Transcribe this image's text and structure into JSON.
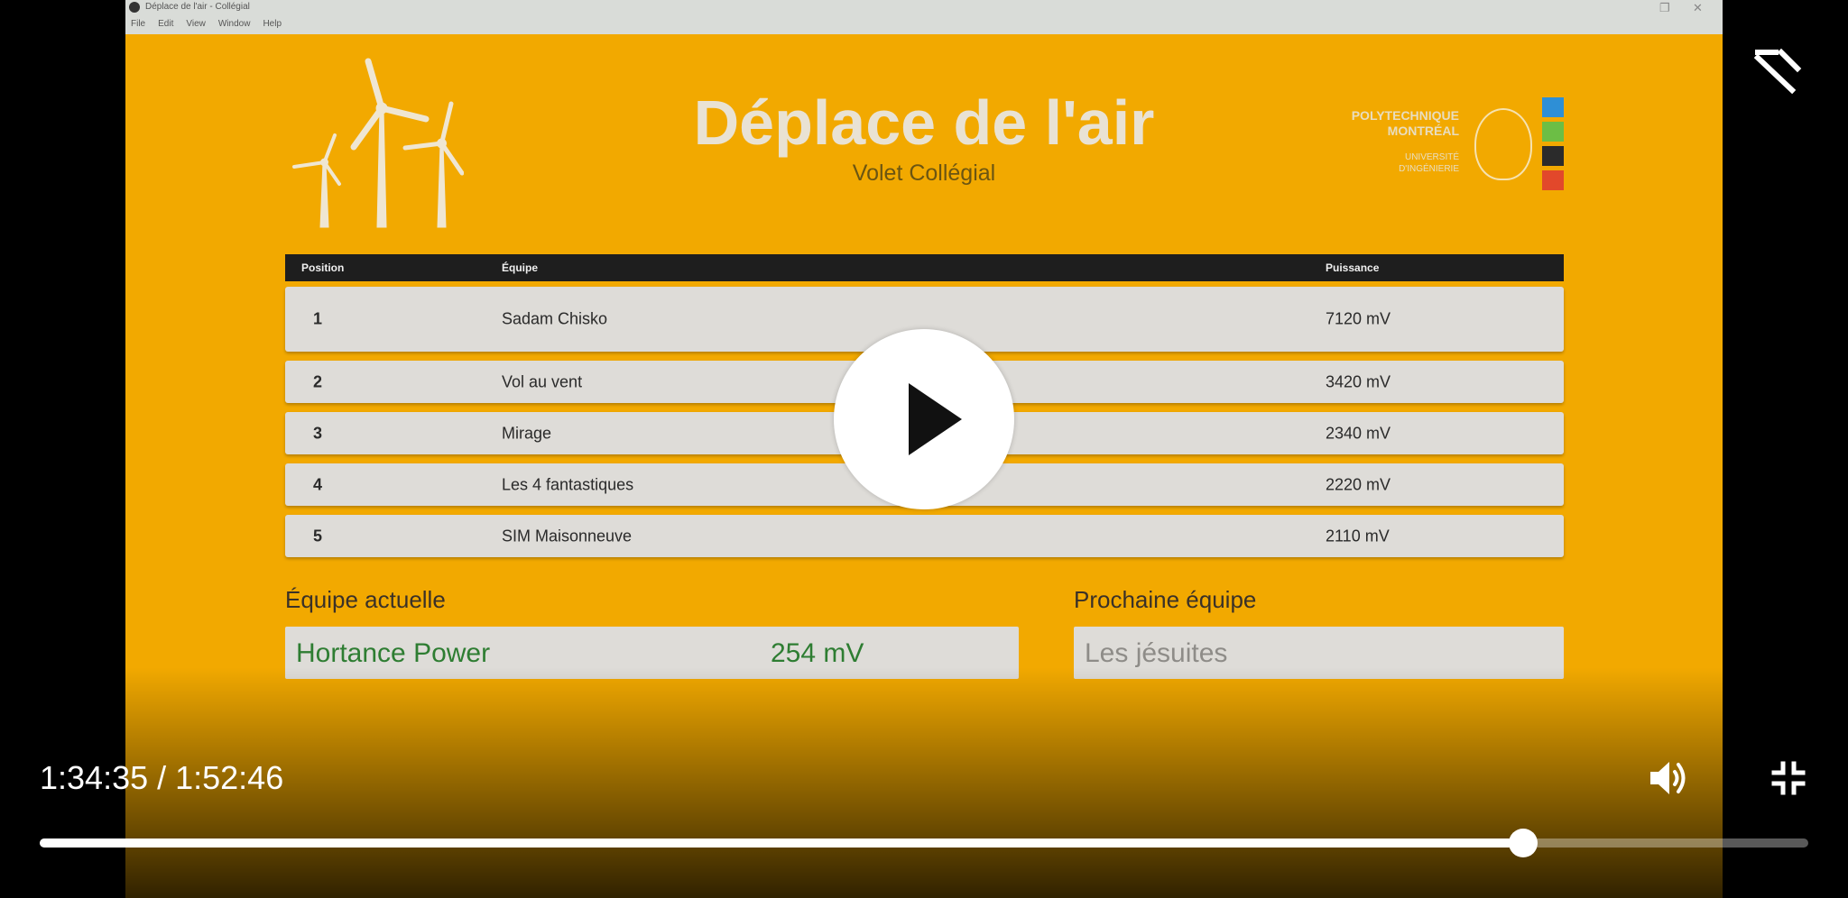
{
  "window": {
    "title": "Déplace de l'air - Collégial",
    "menu": [
      "File",
      "Edit",
      "View",
      "Window",
      "Help"
    ]
  },
  "header": {
    "title": "Déplace de l'air",
    "subtitle": "Volet Collégial"
  },
  "logo": {
    "line1": "POLYTECHNIQUE",
    "line2": "MONTRÉAL",
    "line3": "UNIVERSITÉ",
    "line4": "D'INGÉNIERIE",
    "bar_colors": [
      "#2e8fd6",
      "#6cbe45",
      "#2b2b2b",
      "#e2482b"
    ]
  },
  "table": {
    "headers": [
      "Position",
      "Équipe",
      "Puissance"
    ],
    "rows": [
      {
        "position": "1",
        "team": "Sadam Chisko",
        "power": "7120 mV"
      },
      {
        "position": "2",
        "team": "Vol au vent",
        "power": "3420 mV"
      },
      {
        "position": "3",
        "team": "Mirage",
        "power": "2340 mV"
      },
      {
        "position": "4",
        "team": "Les 4 fantastiques",
        "power": "2220 mV"
      },
      {
        "position": "5",
        "team": "SIM Maisonneuve",
        "power": "2110 mV"
      }
    ]
  },
  "current": {
    "label": "Équipe actuelle",
    "team": "Hortance Power",
    "power": "254 mV"
  },
  "next": {
    "label": "Prochaine équipe",
    "team": "Les jésuites"
  },
  "player": {
    "time": "1:34:35 / 1:52:46",
    "progress": 0.8386,
    "icons": [
      "play-icon",
      "minimize-icon",
      "volume-icon",
      "exit-fullscreen-icon"
    ]
  }
}
